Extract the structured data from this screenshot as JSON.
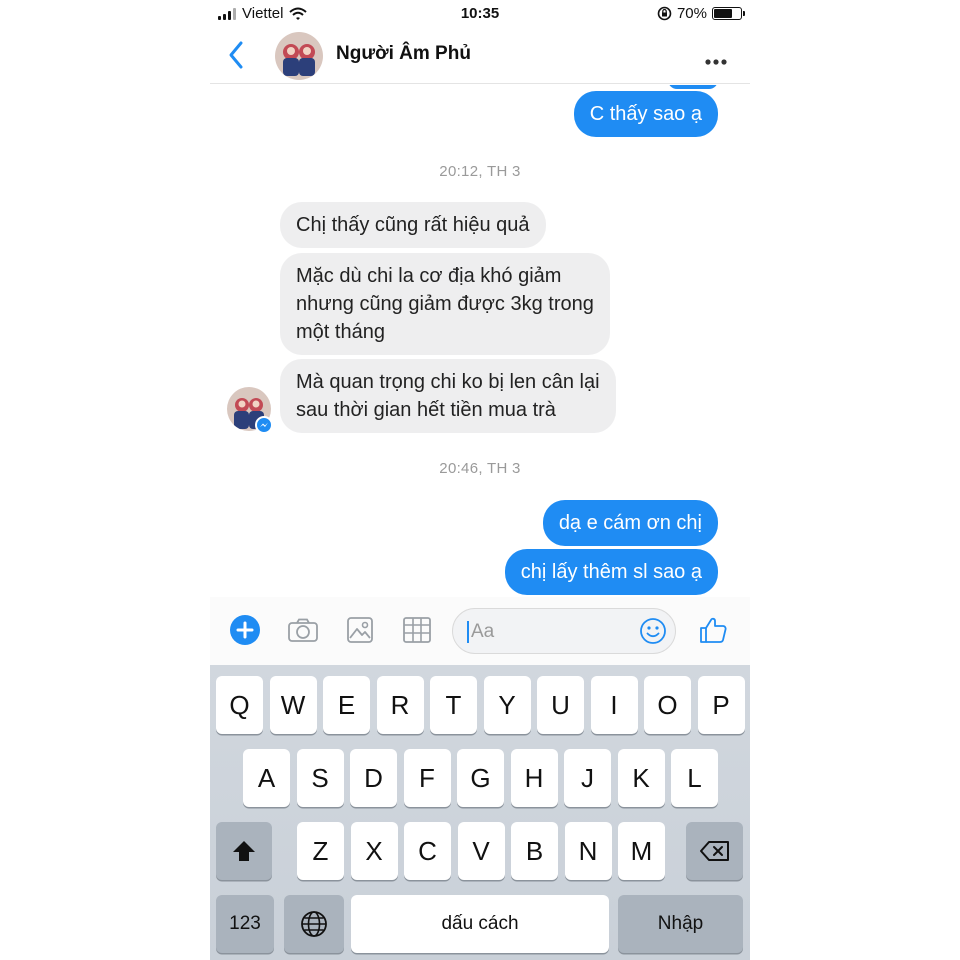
{
  "status_bar": {
    "carrier": "Viettel",
    "time": "10:35",
    "battery_text": "70%",
    "battery_level": 0.7,
    "icons": [
      "signal-icon",
      "wifi-icon",
      "orientation-lock-icon",
      "battery-icon"
    ]
  },
  "header": {
    "title": "Người Âm Phủ",
    "icons": [
      "back-chevron-icon",
      "more-dots-icon"
    ]
  },
  "messages": {
    "out_top": "C thấy sao ạ",
    "ts1": "20:12, TH 3",
    "in1": "Chị thấy cũng rất hiệu quả",
    "in2": [
      "Mặc dù chi la cơ địa khó giảm",
      "nhưng cũng giảm được 3kg trong",
      "một tháng"
    ],
    "in3": [
      "Mà quan trọng chi ko bị len cân lại",
      "sau thời gian hết tiền mua trà"
    ],
    "ts2": "20:46, TH 3",
    "out1": "dạ e cám ơn chị",
    "out2": "chị lấy thêm sl sao ạ"
  },
  "composer": {
    "placeholder": "Aa",
    "icons": [
      "plus-icon",
      "camera-icon",
      "image-icon",
      "grid-apps-icon",
      "emoji-icon",
      "thumbs-up-icon"
    ]
  },
  "keyboard": {
    "row1": [
      "Q",
      "W",
      "E",
      "R",
      "T",
      "Y",
      "U",
      "I",
      "O",
      "P"
    ],
    "row2": [
      "A",
      "S",
      "D",
      "F",
      "G",
      "H",
      "J",
      "K",
      "L"
    ],
    "row3": [
      "Z",
      "X",
      "C",
      "V",
      "B",
      "N",
      "M"
    ],
    "numbers_label": "123",
    "space_label": "dấu cách",
    "return_label": "Nhập",
    "icons": [
      "shift-icon",
      "backspace-icon",
      "globe-icon"
    ]
  },
  "colors": {
    "accent": "#1f8cf3",
    "incoming_bubble": "#eeeeef",
    "keyboard_bg": "#cdd3da"
  }
}
